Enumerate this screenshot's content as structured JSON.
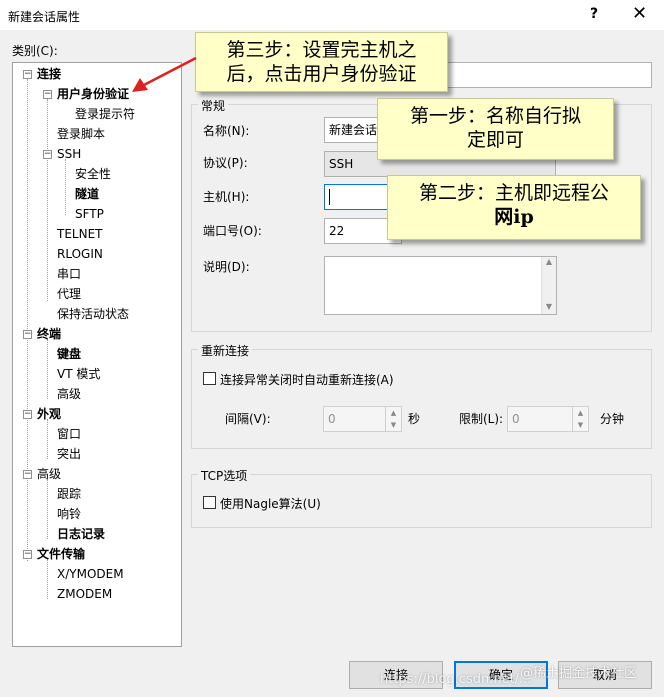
{
  "window": {
    "title": "新建会话属性",
    "help_label": "?",
    "close_label": "✕"
  },
  "category_label": "类别(C):",
  "tree": {
    "connection": "连接",
    "user_auth": "用户身份验证",
    "login_prompt": "登录提示符",
    "login_script": "登录脚本",
    "ssh": "SSH",
    "security": "安全性",
    "tunnel": "隧道",
    "sftp": "SFTP",
    "telnet": "TELNET",
    "rlogin": "RLOGIN",
    "serial": "串口",
    "proxy": "代理",
    "keepalive": "保持活动状态",
    "terminal": "终端",
    "keyboard": "键盘",
    "vt_mode": "VT 模式",
    "advanced": "高级",
    "appearance": "外观",
    "window": "窗口",
    "highlight": "突出",
    "advanced2": "高级",
    "trace": "跟踪",
    "bell": "响铃",
    "logging": "日志记录",
    "file_transfer": "文件传输",
    "xymodem": "X/YMODEM",
    "zmodem": "ZMODEM"
  },
  "general": {
    "group_title": "常规",
    "name_label": "名称(N):",
    "name_value": "新建会话",
    "protocol_label": "协议(P):",
    "protocol_value": "SSH",
    "host_label": "主机(H):",
    "host_value": "",
    "port_label": "端口号(O):",
    "port_value": "22",
    "desc_label": "说明(D):",
    "desc_value": ""
  },
  "reconnect": {
    "group_title": "重新连接",
    "checkbox_label": "连接异常关闭时自动重新连接(A)",
    "interval_label": "间隔(V):",
    "interval_value": "0",
    "interval_unit": "秒",
    "limit_label": "限制(L):",
    "limit_value": "0",
    "limit_unit": "分钟"
  },
  "tcp": {
    "group_title": "TCP选项",
    "nagle_label": "使用Nagle算法(U)"
  },
  "buttons": {
    "connect": "连接",
    "ok": "确定",
    "cancel": "取消"
  },
  "callouts": {
    "step3_line1": "第三步：设置完主机之",
    "step3_line2": "后，点击用户身份验证",
    "step1_line1": "第一步：名称自行拟",
    "step1_line2": "定即可",
    "step2_line1": "第二步：主机即远程公",
    "step2_line2": "网ip"
  },
  "watermarks": {
    "left": "https://blog.csdn.net/...",
    "right": "@稀土掘金技术社区"
  },
  "colors": {
    "callout_bg": "#ffffc8",
    "arrow": "#e02020",
    "focus": "#0078d7"
  }
}
